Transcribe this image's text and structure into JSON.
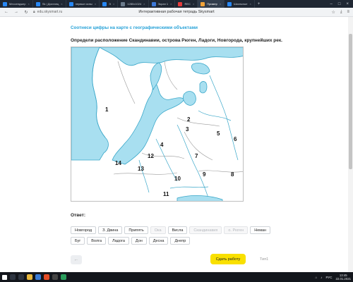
{
  "browser": {
    "tabs": [
      {
        "label": "Мессенджер",
        "color": "#2787f5"
      },
      {
        "label": "Sk | Дистанц",
        "color": "#2787f5"
      },
      {
        "label": "первые испы",
        "color": "#2787f5"
      },
      {
        "label": "Э",
        "color": "#2787f5"
      },
      {
        "label": "1280x1024",
        "color": "#6b7b8c"
      },
      {
        "label": "Экран 1",
        "color": "#3c78d8"
      },
      {
        "label": "REC",
        "color": "#e33b3b"
      },
      {
        "label": "Пример",
        "color": "#f1a33a"
      },
      {
        "label": "Школьные",
        "color": "#2787f5"
      }
    ],
    "url": "edu.skysmart.ru",
    "page_title": "Интерактивная рабочая тетрадь Skysmart"
  },
  "task": {
    "title": "Соотнеси цифры на карте с географическими объектами",
    "instruction": "Определи расположение Скандинавии, острова Рюген, Ладоги, Новгорода, крупнейших рек.",
    "map_labels": [
      {
        "text": "1"
      },
      {
        "text": "2"
      },
      {
        "text": "3"
      },
      {
        "text": "4"
      },
      {
        "text": "5"
      },
      {
        "text": "6"
      },
      {
        "text": "7"
      },
      {
        "text": "8"
      },
      {
        "text": "9"
      },
      {
        "text": "10"
      },
      {
        "text": "11"
      },
      {
        "text": "12"
      },
      {
        "text": "13"
      },
      {
        "text": "14"
      }
    ],
    "answer_label": "Ответ:",
    "options": [
      {
        "label": "Новгород",
        "disabled": false
      },
      {
        "label": "З. Двина",
        "disabled": false
      },
      {
        "label": "Припять",
        "disabled": false
      },
      {
        "label": "Ока",
        "disabled": true
      },
      {
        "label": "Висла",
        "disabled": false
      },
      {
        "label": "Скандинавия",
        "disabled": true
      },
      {
        "label": "о. Рюген",
        "disabled": true
      },
      {
        "label": "Неман",
        "disabled": false
      },
      {
        "label": "Буг",
        "disabled": false
      },
      {
        "label": "Волга",
        "disabled": false
      },
      {
        "label": "Ладога",
        "disabled": false
      },
      {
        "label": "Дон",
        "disabled": false
      },
      {
        "label": "Десна",
        "disabled": false
      },
      {
        "label": "Днепр",
        "disabled": false
      }
    ]
  },
  "footer": {
    "back_icon": "arrow-left-icon",
    "submit_label": "Сдать работу",
    "task_count": "Тип1"
  },
  "taskbar": {
    "tray_lang": "РУС",
    "time": "13:45",
    "date": "22.01.2021"
  },
  "colors": {
    "accent": "#27a2d8",
    "water": "#a8dff0",
    "submit": "#f9e000"
  }
}
